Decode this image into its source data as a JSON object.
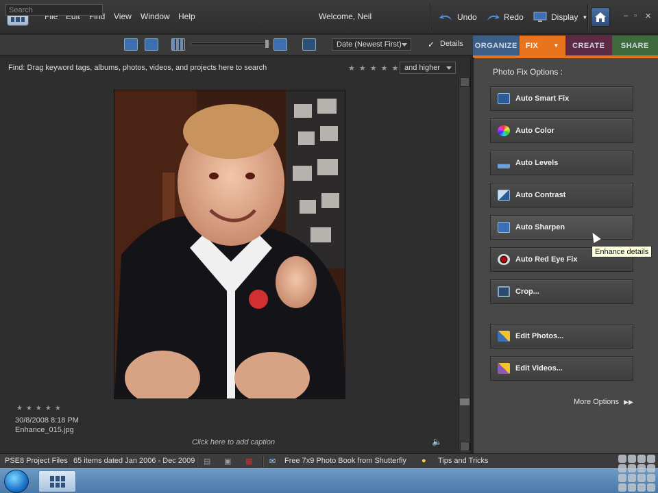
{
  "menubar": {
    "items": [
      "File",
      "Edit",
      "Find",
      "View",
      "Window",
      "Help"
    ],
    "welcome": "Welcome, Neil",
    "undo_label": "Undo",
    "redo_label": "Redo",
    "display_label": "Display"
  },
  "toolbar": {
    "search_placeholder": "Search",
    "sort_value": "Date (Newest First)",
    "details_label": "Details",
    "details_checked": true
  },
  "tabs": [
    {
      "label": "ORGANIZE",
      "color": "#3d5e86"
    },
    {
      "label": "FIX",
      "color": "#e8741e"
    },
    {
      "label": "CREATE",
      "color": "#5c2a44"
    },
    {
      "label": "SHARE",
      "color": "#3f6b3c"
    }
  ],
  "browser": {
    "find_text": "Find: Drag keyword tags, albums, photos, videos, and projects here to search",
    "rating_filter": "and higher",
    "photo": {
      "date": "30/8/2008 8:18 PM",
      "filename": "Enhance_015.jpg"
    },
    "caption_placeholder": "Click here to add caption"
  },
  "fix_panel": {
    "title": "Photo Fix Options :",
    "buttons": [
      {
        "label": "Auto Smart Fix",
        "icon": "smart-fix-icon"
      },
      {
        "label": "Auto Color",
        "icon": "color-wheel-icon"
      },
      {
        "label": "Auto Levels",
        "icon": "levels-icon"
      },
      {
        "label": "Auto Contrast",
        "icon": "contrast-icon"
      },
      {
        "label": "Auto Sharpen",
        "icon": "sharpen-icon"
      },
      {
        "label": "Auto Red Eye Fix",
        "icon": "red-eye-icon"
      },
      {
        "label": "Crop...",
        "icon": "crop-icon"
      },
      {
        "label": "Edit Photos...",
        "icon": "edit-photos-icon"
      },
      {
        "label": "Edit Videos...",
        "icon": "edit-videos-icon"
      }
    ],
    "more_options": "More Options",
    "tooltip": "Enhance details"
  },
  "status": {
    "catalog": "PSE8 Project Files",
    "items": "65 items dated Jan 2006 - Dec 2009",
    "promo": "Free 7x9 Photo Book from Shutterfly",
    "tips": "Tips and Tricks"
  }
}
